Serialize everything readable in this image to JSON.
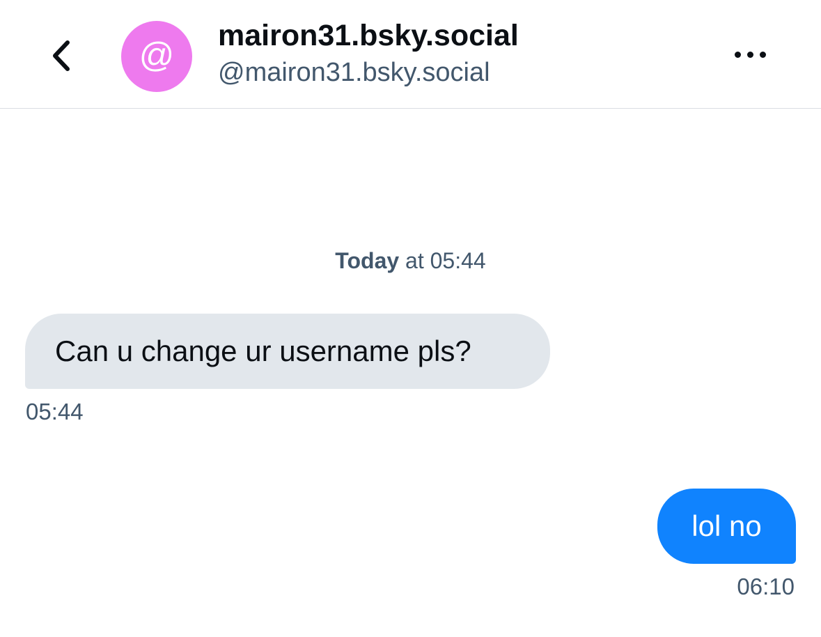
{
  "header": {
    "display_name": "mairon31.bsky.social",
    "handle": "@mairon31.bsky.social",
    "avatar_glyph": "@",
    "back_icon": "chevron-left-icon",
    "more_icon": "more-horizontal-icon"
  },
  "colors": {
    "avatar_bg": "#ee7aee",
    "incoming_bubble": "#e2e7ec",
    "outgoing_bubble": "#1083fe",
    "secondary_text": "#42576c"
  },
  "conversation": {
    "date_separator": {
      "bold": "Today",
      "rest": " at 05:44"
    },
    "messages": [
      {
        "direction": "incoming",
        "text": "Can u change ur username pls?",
        "time": "05:44"
      },
      {
        "direction": "outgoing",
        "text": "lol no",
        "time": "06:10"
      }
    ]
  }
}
